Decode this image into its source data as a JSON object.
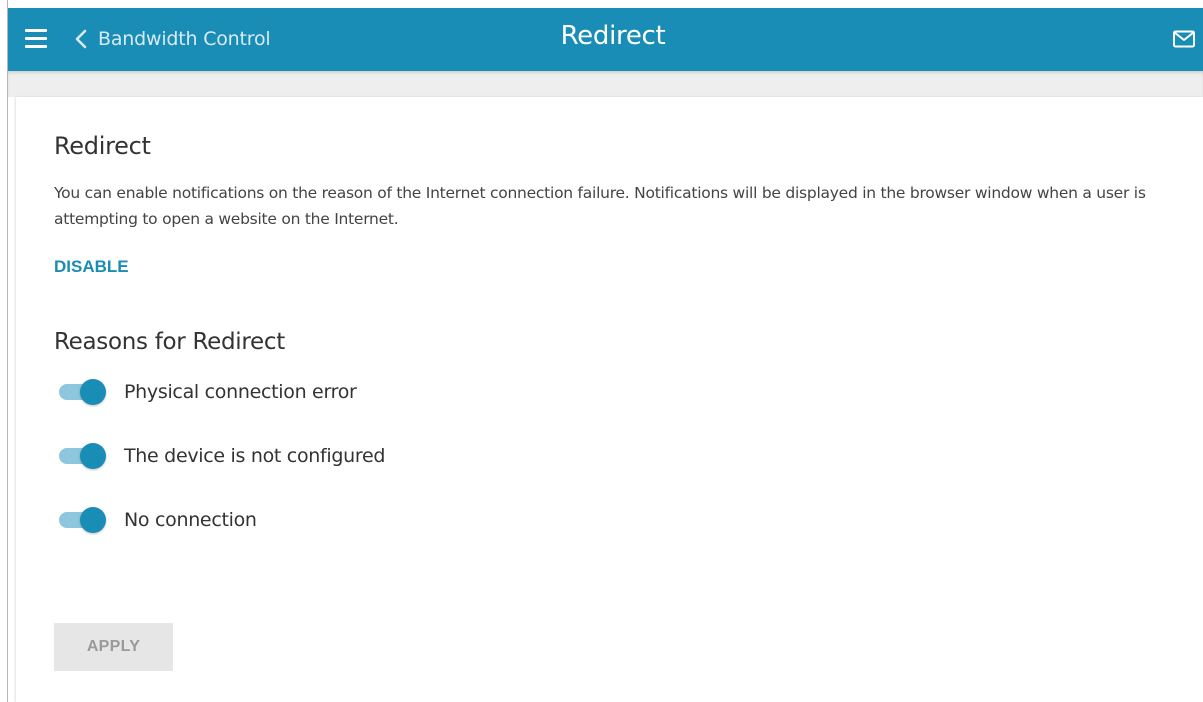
{
  "header": {
    "back_label": "Bandwidth Control",
    "title": "Redirect",
    "menu_icon": "hamburger-icon",
    "back_icon": "chevron-left-icon",
    "mail_icon": "envelope-icon",
    "background_color": "#1a8db6"
  },
  "section": {
    "title": "Redirect",
    "description": "You can enable notifications on the reason of the Internet connection failure. Notifications will be displayed in the browser window when a user is attempting to open a website on the Internet.",
    "disable_label": "DISABLE"
  },
  "reasons": {
    "title": "Reasons for Redirect",
    "items": [
      {
        "label": "Physical connection error",
        "enabled": true
      },
      {
        "label": "The device is not configured",
        "enabled": true
      },
      {
        "label": "No connection",
        "enabled": true
      }
    ]
  },
  "actions": {
    "apply_label": "APPLY",
    "apply_enabled": false
  },
  "colors": {
    "accent": "#1a8db6",
    "toggle_track": "#8ec7dd",
    "button_disabled_bg": "#e6e6e6",
    "button_disabled_text": "#9a9a9a"
  }
}
